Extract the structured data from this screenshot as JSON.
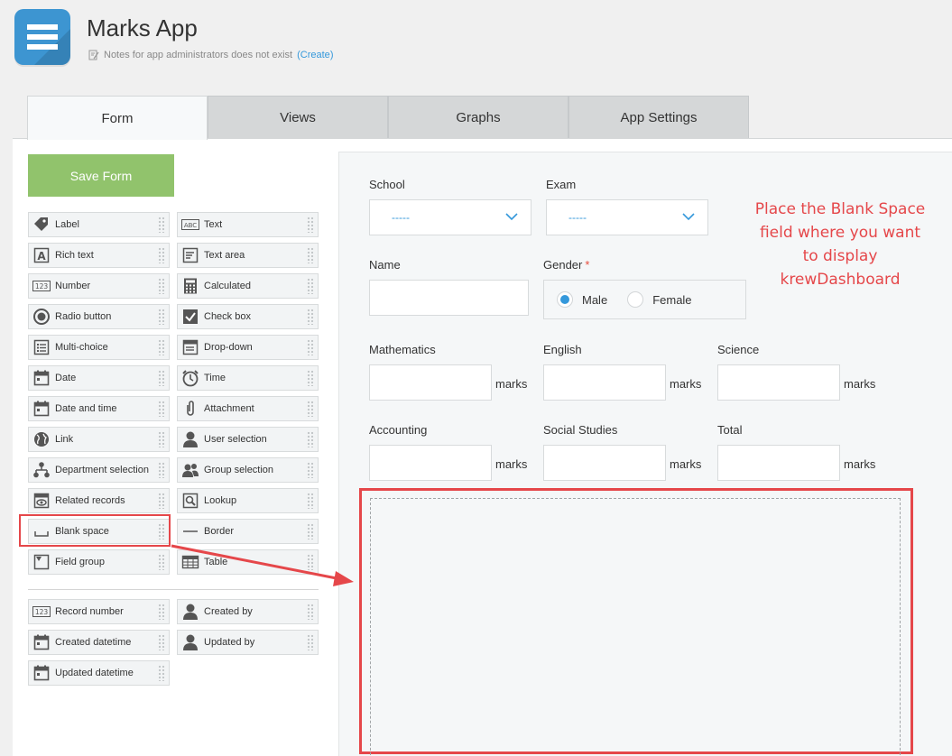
{
  "app": {
    "title": "Marks App",
    "notes_text": "Notes for app administrators does not exist",
    "create_link_prefix": "(",
    "create_link": "Create",
    "create_link_suffix": ")"
  },
  "tabs": [
    {
      "label": "Form",
      "active": true
    },
    {
      "label": "Views",
      "active": false
    },
    {
      "label": "Graphs",
      "active": false
    },
    {
      "label": "App Settings",
      "active": false
    }
  ],
  "toolbar": {
    "save_label": "Save Form"
  },
  "palette": {
    "fields": [
      {
        "label": "Label",
        "icon": "tag-icon"
      },
      {
        "label": "Text",
        "icon": "abc-text-icon"
      },
      {
        "label": "Rich text",
        "icon": "rich-text-icon"
      },
      {
        "label": "Text area",
        "icon": "text-area-icon"
      },
      {
        "label": "Number",
        "icon": "number-123-icon"
      },
      {
        "label": "Calculated",
        "icon": "calculator-icon"
      },
      {
        "label": "Radio button",
        "icon": "radio-icon"
      },
      {
        "label": "Check box",
        "icon": "checkbox-icon"
      },
      {
        "label": "Multi-choice",
        "icon": "multi-choice-icon"
      },
      {
        "label": "Drop-down",
        "icon": "dropdown-icon"
      },
      {
        "label": "Date",
        "icon": "calendar-icon"
      },
      {
        "label": "Time",
        "icon": "clock-icon"
      },
      {
        "label": "Date and time",
        "icon": "calendar-icon"
      },
      {
        "label": "Attachment",
        "icon": "paperclip-icon"
      },
      {
        "label": "Link",
        "icon": "globe-icon"
      },
      {
        "label": "User selection",
        "icon": "user-icon"
      },
      {
        "label": "Department selection",
        "icon": "org-chart-icon"
      },
      {
        "label": "Group selection",
        "icon": "group-icon"
      },
      {
        "label": "Related records",
        "icon": "related-records-icon"
      },
      {
        "label": "Lookup",
        "icon": "lookup-icon"
      },
      {
        "label": "Blank space",
        "icon": "blank-space-icon"
      },
      {
        "label": "Border",
        "icon": "border-line-icon"
      },
      {
        "label": "Field group",
        "icon": "field-group-icon"
      },
      {
        "label": "Table",
        "icon": "table-icon"
      }
    ],
    "system_fields": [
      {
        "label": "Record number",
        "icon": "number-123-icon"
      },
      {
        "label": "Created by",
        "icon": "user-icon"
      },
      {
        "label": "Created datetime",
        "icon": "calendar-icon"
      },
      {
        "label": "Updated by",
        "icon": "user-icon"
      },
      {
        "label": "Updated datetime",
        "icon": "calendar-icon"
      }
    ]
  },
  "form": {
    "school": {
      "label": "School",
      "value": "-----"
    },
    "exam": {
      "label": "Exam",
      "value": "-----"
    },
    "name": {
      "label": "Name"
    },
    "gender": {
      "label": "Gender",
      "required_mark": "*",
      "options": [
        "Male",
        "Female"
      ],
      "selected": "Male"
    },
    "unit": "marks",
    "mathematics": {
      "label": "Mathematics"
    },
    "english": {
      "label": "English"
    },
    "science": {
      "label": "Science"
    },
    "accounting": {
      "label": "Accounting"
    },
    "social_studies": {
      "label": "Social Studies"
    },
    "total": {
      "label": "Total"
    }
  },
  "annotation": {
    "text_line1": "Place the Blank Space",
    "text_line2": "field where you want",
    "text_line3": "to display",
    "text_line4": "krewDashboard",
    "color": "#e5474a"
  },
  "colors": {
    "save_button": "#91c36c",
    "accent": "#3498db",
    "annotation": "#e5474a"
  }
}
